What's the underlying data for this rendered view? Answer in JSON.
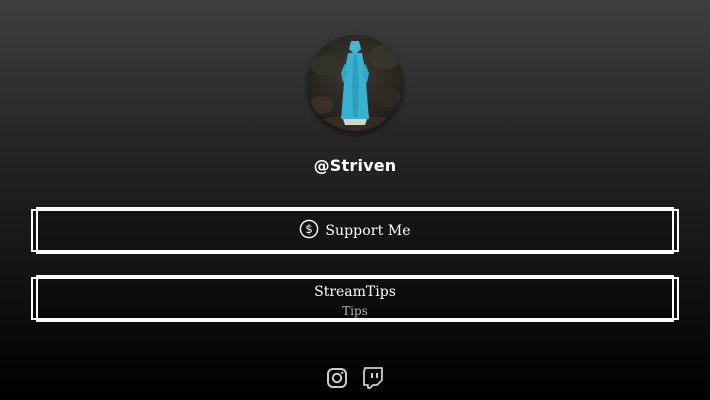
{
  "profile": {
    "handle": "@Striven",
    "avatar_icon": "profile-photo-blue-statue"
  },
  "links": [
    {
      "label": "Support Me",
      "icon": "dollar-circle-icon"
    },
    {
      "title": "StreamTips",
      "subtitle": "Tips"
    }
  ],
  "social": [
    {
      "icon": "instagram-icon"
    },
    {
      "icon": "twitch-icon"
    }
  ],
  "colors": {
    "background_top": "#3f3f3f",
    "background_bottom": "#000000",
    "text": "#ffffff",
    "subtext": "#b3b3b3",
    "button_border": "#ffffff",
    "social_icon": "#cccccc"
  }
}
